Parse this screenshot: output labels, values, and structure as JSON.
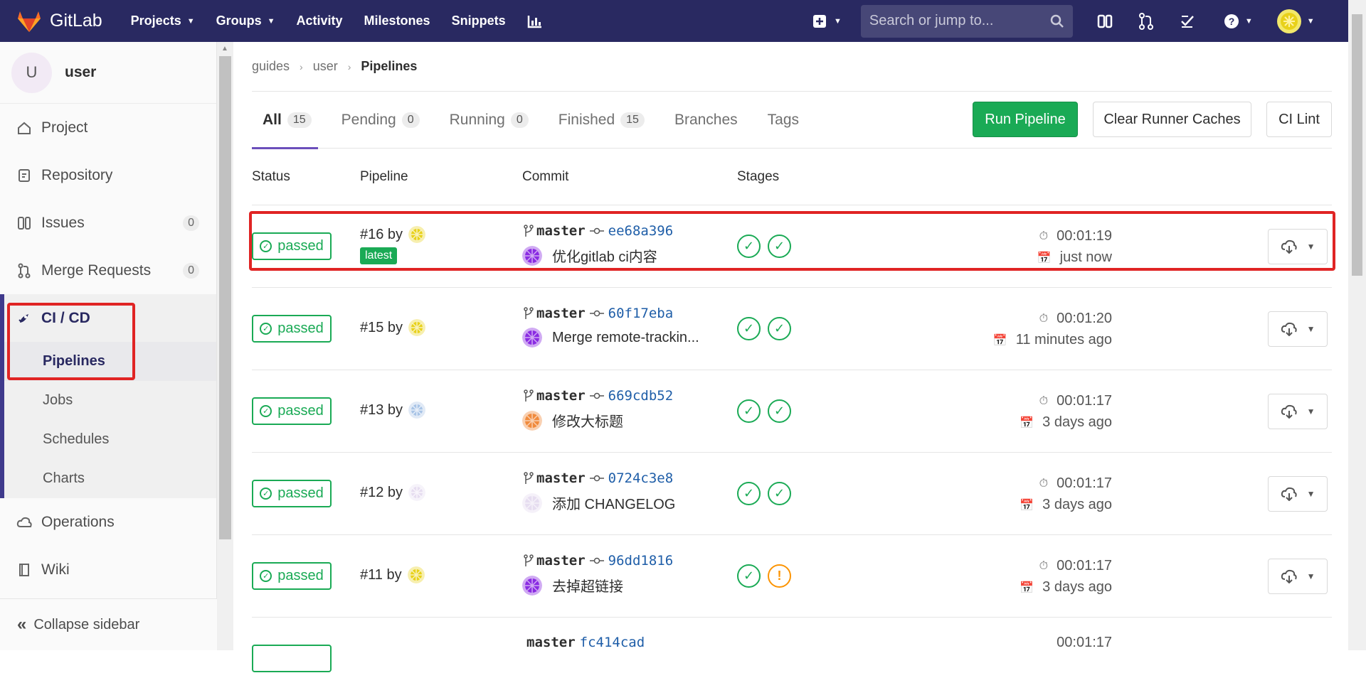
{
  "navbar": {
    "brand": "GitLab",
    "items": [
      "Projects",
      "Groups",
      "Activity",
      "Milestones",
      "Snippets"
    ],
    "search_placeholder": "Search or jump to..."
  },
  "sidebar": {
    "avatar_letter": "U",
    "project_name": "user",
    "items": [
      {
        "label": "Project",
        "icon": "home-icon"
      },
      {
        "label": "Repository",
        "icon": "doc-icon"
      },
      {
        "label": "Issues",
        "icon": "issues-icon",
        "count": "0"
      },
      {
        "label": "Merge Requests",
        "icon": "merge-request-icon",
        "count": "0"
      }
    ],
    "active": {
      "label": "CI / CD",
      "icon": "rocket-icon"
    },
    "subitems": [
      "Pipelines",
      "Jobs",
      "Schedules",
      "Charts"
    ],
    "after": [
      {
        "label": "Operations",
        "icon": "cloud-icon"
      },
      {
        "label": "Wiki",
        "icon": "book-icon"
      }
    ],
    "collapse_label": "Collapse sidebar"
  },
  "breadcrumb": [
    "guides",
    "user",
    "Pipelines"
  ],
  "tabs": [
    {
      "label": "All",
      "count": "15"
    },
    {
      "label": "Pending",
      "count": "0"
    },
    {
      "label": "Running",
      "count": "0"
    },
    {
      "label": "Finished",
      "count": "15"
    },
    {
      "label": "Branches"
    },
    {
      "label": "Tags"
    }
  ],
  "buttons": {
    "run": "Run Pipeline",
    "clear": "Clear Runner Caches",
    "lint": "CI Lint"
  },
  "columns": [
    "Status",
    "Pipeline",
    "Commit",
    "Stages"
  ],
  "rows": [
    {
      "status": "passed",
      "pipeline": "#16 by",
      "latest": "latest",
      "branch": "master",
      "sha": "ee68a396",
      "message": "优化gitlab ci内容",
      "stages": [
        "success",
        "success"
      ],
      "duration": "00:01:19",
      "finished": "just now",
      "avatar_color": "#e8d11a",
      "commit_avatar_color": "#8a2be2"
    },
    {
      "status": "passed",
      "pipeline": "#15 by",
      "branch": "master",
      "sha": "60f17eba",
      "message": "Merge remote-trackin...",
      "stages": [
        "success",
        "success"
      ],
      "duration": "00:01:20",
      "finished": "11 minutes ago",
      "avatar_color": "#e8d11a",
      "commit_avatar_color": "#8a2be2"
    },
    {
      "status": "passed",
      "pipeline": "#13 by",
      "branch": "master",
      "sha": "669cdb52",
      "message": "修改大标题",
      "stages": [
        "success",
        "success"
      ],
      "duration": "00:01:17",
      "finished": "3 days ago",
      "avatar_color": "#a8c4e6",
      "commit_avatar_color": "#f08a3c"
    },
    {
      "status": "passed",
      "pipeline": "#12 by",
      "branch": "master",
      "sha": "0724c3e8",
      "message": "添加  CHANGELOG",
      "stages": [
        "success",
        "success"
      ],
      "duration": "00:01:17",
      "finished": "3 days ago",
      "avatar_color": "#e6ddf0",
      "commit_avatar_color": "#e6ddf0"
    },
    {
      "status": "passed",
      "pipeline": "#11 by",
      "branch": "master",
      "sha": "96dd1816",
      "message": "去掉超链接",
      "stages": [
        "success",
        "warning"
      ],
      "duration": "00:01:17",
      "finished": "3 days ago",
      "avatar_color": "#e8d11a",
      "commit_avatar_color": "#8a2be2"
    }
  ],
  "partial_row": {
    "branch": "master",
    "sha": "fc414cad",
    "duration": "00:01:17"
  }
}
